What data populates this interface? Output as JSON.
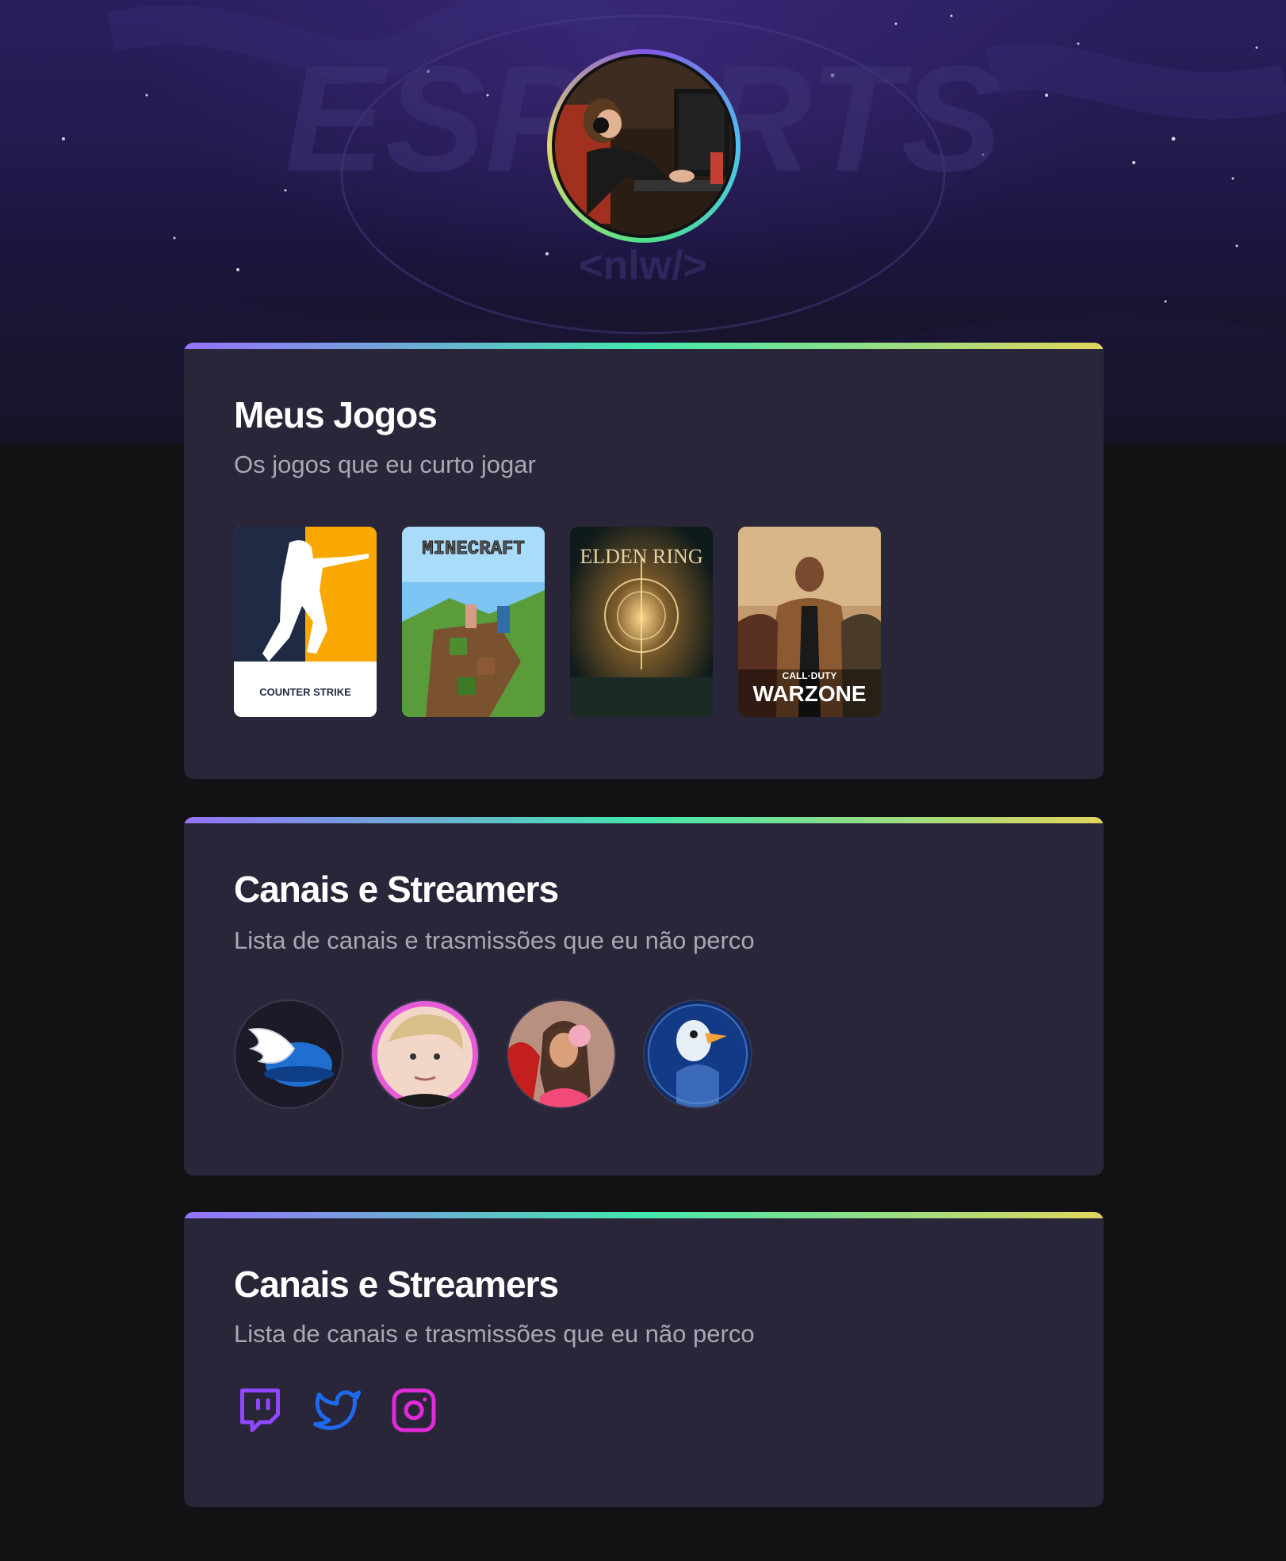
{
  "hero": {
    "brand_watermark": "ESPORTS",
    "brand_tag": "<nlw/>",
    "avatar_alt": "profile photo"
  },
  "cards": [
    {
      "title": "Meus Jogos",
      "subtitle": "Os jogos que eu curto jogar",
      "games": [
        {
          "name": "Counter-Strike",
          "label": "COUNTER STRIKE",
          "accent": "#f8a800"
        },
        {
          "name": "Minecraft",
          "label": "MINECRAFT",
          "accent": "#5fa83a"
        },
        {
          "name": "Elden Ring",
          "label": "ELDEN RING",
          "accent": "#d9a441"
        },
        {
          "name": "Call of Duty Warzone",
          "label_top": "CALL·DUTY",
          "label": "WARZONE",
          "accent": "#c08a4a"
        }
      ]
    },
    {
      "title": "Canais e Streamers",
      "subtitle": "Lista de canais e trasmissões que eu não perco",
      "streamers": [
        {
          "name": "streamer-1"
        },
        {
          "name": "streamer-2"
        },
        {
          "name": "streamer-3"
        },
        {
          "name": "streamer-4"
        }
      ]
    },
    {
      "title": "Canais e Streamers",
      "subtitle": "Lista de canais e trasmissões que eu não perco",
      "socials": [
        {
          "icon": "twitch-icon",
          "color": "#9146ff"
        },
        {
          "icon": "twitter-icon",
          "color": "#1d9bf0"
        },
        {
          "icon": "instagram-icon",
          "color": "#e12ad8"
        }
      ]
    }
  ]
}
